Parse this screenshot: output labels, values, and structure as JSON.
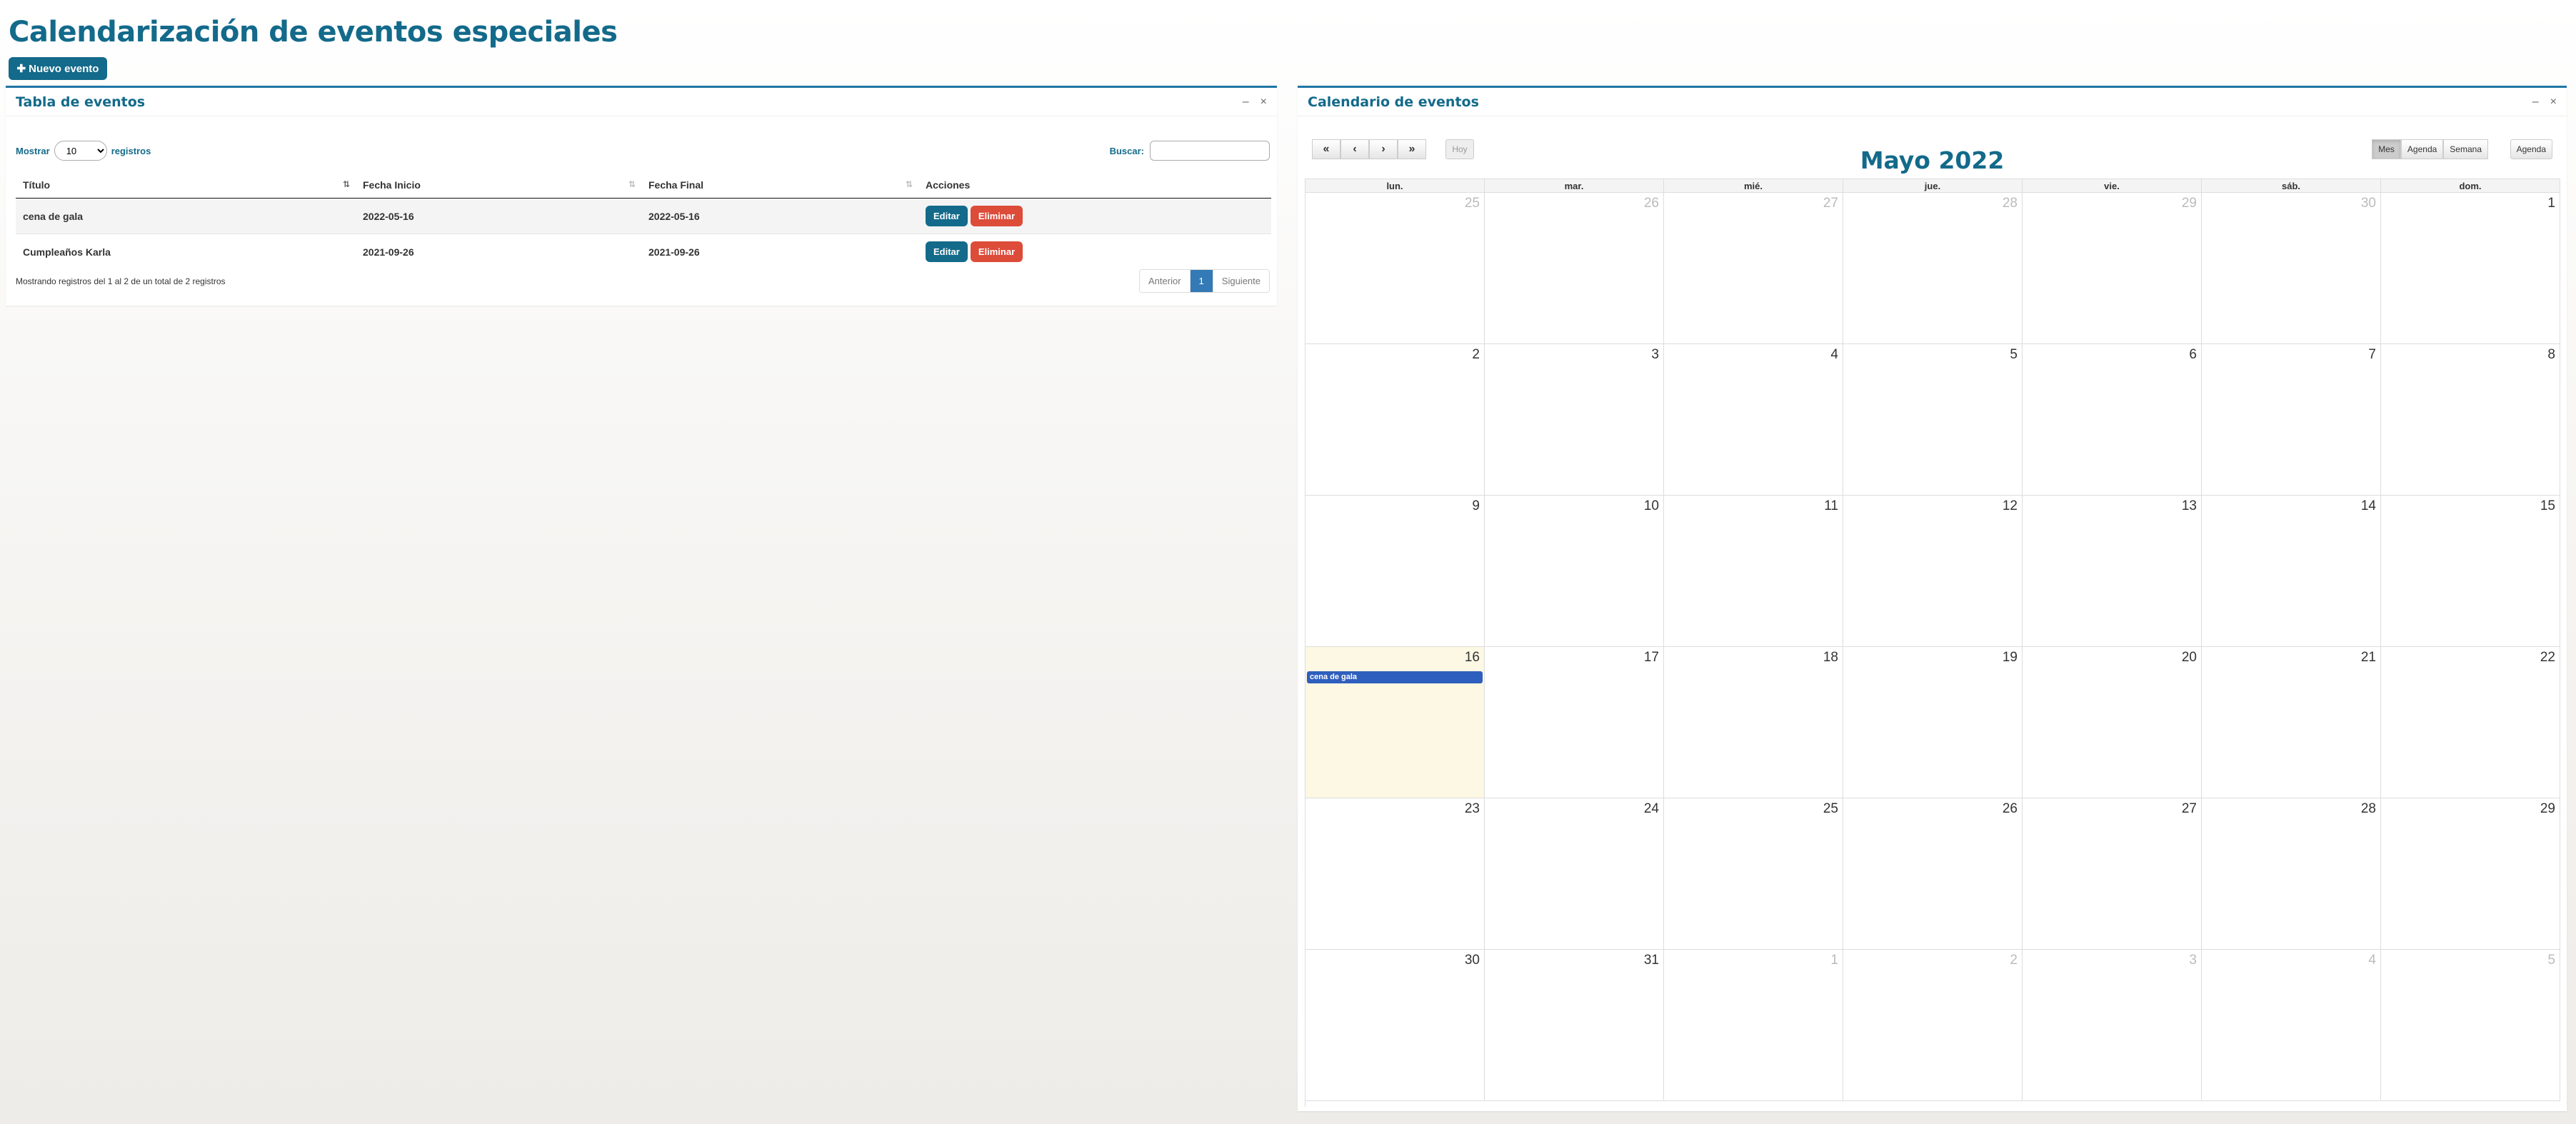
{
  "page": {
    "title": "Calendarización de eventos especiales",
    "new_button": "Nuevo evento"
  },
  "table_panel": {
    "title": "Tabla de eventos",
    "minimize": "–",
    "close": "×",
    "length_prefix": "Mostrar",
    "length_value": "10",
    "length_suffix": "registros",
    "search_label": "Buscar:",
    "search_value": "",
    "columns": [
      "Título",
      "Fecha Inicio",
      "Fecha Final",
      "Acciones"
    ],
    "rows": [
      {
        "title": "cena de gala",
        "start": "2022-05-16",
        "end": "2022-05-16"
      },
      {
        "title": "Cumpleaños Karla",
        "start": "2021-09-26",
        "end": "2021-09-26"
      }
    ],
    "edit_label": "Editar",
    "delete_label": "Eliminar",
    "info": "Mostrando registros del 1 al 2 de un total de 2 registros",
    "pager": {
      "prev": "Anterior",
      "current": "1",
      "next": "Siguiente"
    }
  },
  "calendar_panel": {
    "title": "Calendario de eventos",
    "minimize": "–",
    "close": "×",
    "month_title": "Mayo 2022",
    "today_label": "Hoy",
    "views": [
      "Mes",
      "Agenda",
      "Semana"
    ],
    "agenda_label": "Agenda",
    "dow": [
      "lun.",
      "mar.",
      "mié.",
      "jue.",
      "vie.",
      "sáb.",
      "dom."
    ],
    "weeks": [
      [
        "25",
        "26",
        "27",
        "28",
        "29",
        "30",
        "1"
      ],
      [
        "2",
        "3",
        "4",
        "5",
        "6",
        "7",
        "8"
      ],
      [
        "9",
        "10",
        "11",
        "12",
        "13",
        "14",
        "15"
      ],
      [
        "16",
        "17",
        "18",
        "19",
        "20",
        "21",
        "22"
      ],
      [
        "23",
        "24",
        "25",
        "26",
        "27",
        "28",
        "29"
      ],
      [
        "30",
        "31",
        "1",
        "2",
        "3",
        "4",
        "5"
      ]
    ],
    "event": {
      "label": "cena de gala",
      "color": "#2e5fbe"
    }
  }
}
